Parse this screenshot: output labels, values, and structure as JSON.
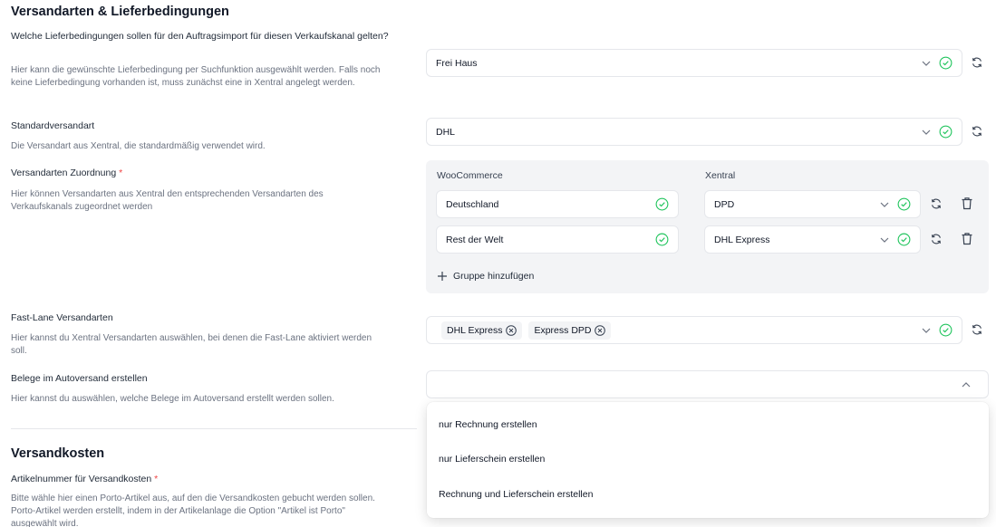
{
  "shipping": {
    "heading": "Versandarten & Lieferbedingungen",
    "delivery_terms": {
      "label": "Welche Lieferbedingungen sollen für den Auftragsimport für diesen Verkaufskanal gelten?",
      "description": "Hier kann die gewünschte Lieferbedingung per Suchfunktion ausgewählt werden. Falls noch keine Lieferbedingung vorhanden ist, muss zunächst eine in Xentral angelegt werden.",
      "value": "Frei Haus"
    },
    "default_method": {
      "label": "Standardversandart",
      "description": "Die Versandart aus Xentral, die standardmäßig verwendet wird.",
      "value": "DHL"
    },
    "mapping": {
      "label": "Versandarten Zuordnung",
      "required_mark": "*",
      "description": "Hier können Versandarten aus Xentral den entsprechenden Versandarten des Verkaufskanals zugeordnet werden",
      "col_left": "WooCommerce",
      "col_right": "Xentral",
      "rows": [
        {
          "source": "Deutschland",
          "target": "DPD"
        },
        {
          "source": "Rest der Welt",
          "target": "DHL Express"
        }
      ],
      "add_group_label": "Gruppe hinzufügen"
    },
    "fast_lane": {
      "label": "Fast-Lane Versandarten",
      "description": "Hier kannst du Xentral Versandarten auswählen, bei denen die Fast-Lane aktiviert werden soll.",
      "tags": [
        "DHL Express",
        "Express DPD"
      ]
    },
    "auto_documents": {
      "label": "Belege im Autoversand erstellen",
      "description": "Hier kannst du auswählen, welche Belege im Autoversand erstellt werden sollen.",
      "value": "",
      "options": [
        "nur Rechnung erstellen",
        "nur Lieferschein erstellen",
        "Rechnung und Lieferschein erstellen"
      ]
    }
  },
  "costs": {
    "heading": "Versandkosten",
    "article_number": {
      "label": "Artikelnummer für Versandkosten",
      "required_mark": "*",
      "description": "Bitte wähle hier einen Porto-Artikel aus, auf den die Versandkosten gebucht werden sollen. Porto-Artikel werden erstellt, indem in der Artikelanlage die Option \"Artikel ist Porto\" ausgewählt wird."
    }
  },
  "colors": {
    "success": "#22c55e",
    "required": "#ef4444",
    "panel_bg": "#f3f4f6"
  }
}
